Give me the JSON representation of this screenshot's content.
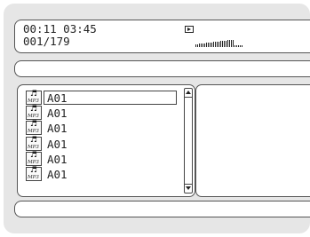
{
  "player": {
    "elapsed_time": "00:11",
    "total_time": "03:45",
    "track_position": "001/179",
    "play_state_icon": "play-icon",
    "level_meter": 0.82
  },
  "file_list": {
    "items": [
      {
        "label": "A01",
        "icon": "mp3-file-icon",
        "selected": true
      },
      {
        "label": "A01",
        "icon": "mp3-file-icon",
        "selected": false
      },
      {
        "label": "A01",
        "icon": "mp3-file-icon",
        "selected": false
      },
      {
        "label": "A01",
        "icon": "mp3-file-icon",
        "selected": false
      },
      {
        "label": "A01",
        "icon": "mp3-file-icon",
        "selected": false
      },
      {
        "label": "A01",
        "icon": "mp3-file-icon",
        "selected": false
      }
    ],
    "icon_text": "MP3"
  },
  "colors": {
    "background": "#e6e6e6",
    "panel": "#ffffff",
    "border": "#555555"
  }
}
